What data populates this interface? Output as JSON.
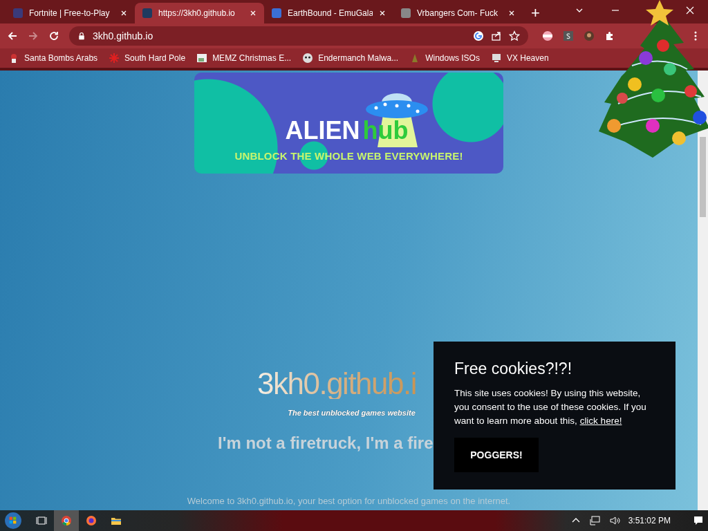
{
  "browser": {
    "tabs": [
      {
        "title": "Fortnite | Free-to-Play",
        "selected": false
      },
      {
        "title": "https://3kh0.github.io",
        "selected": true
      },
      {
        "title": "EarthBound - EmuGala",
        "selected": false
      },
      {
        "title": "Vrbangers Com- Fuck",
        "selected": false
      }
    ],
    "new_tab": "+",
    "forward_disabled": true,
    "address": "3kh0.github.io",
    "bookmarks": [
      {
        "label": "Santa Bombs Arabs"
      },
      {
        "label": "South Hard Pole"
      },
      {
        "label": "MEMZ Christmas E..."
      },
      {
        "label": "Endermanch Malwa..."
      },
      {
        "label": "Windows ISOs"
      },
      {
        "label": "VX Heaven"
      }
    ]
  },
  "page": {
    "banner": {
      "title": "ALIEN",
      "title_accent": "hub",
      "tagline": "UNBLOCK THE WHOLE WEB EVERYWHERE!"
    },
    "site_title": "3kh0.github.i",
    "subtitle": "The best unblocked games website",
    "heading": "I'm not a firetruck, I'm a fire",
    "welcome": "Welcome to 3kh0.github.io, your best option for unblocked games on the internet."
  },
  "cookie_popup": {
    "title": "Free cookies?!?!",
    "text": "This site uses cookies! By using this website, you consent to the use of these cookies. If you want to learn more about this,",
    "link": "click here!",
    "button": "POGGERS!"
  },
  "taskbar": {
    "clock": "3:51:02 PM"
  }
}
